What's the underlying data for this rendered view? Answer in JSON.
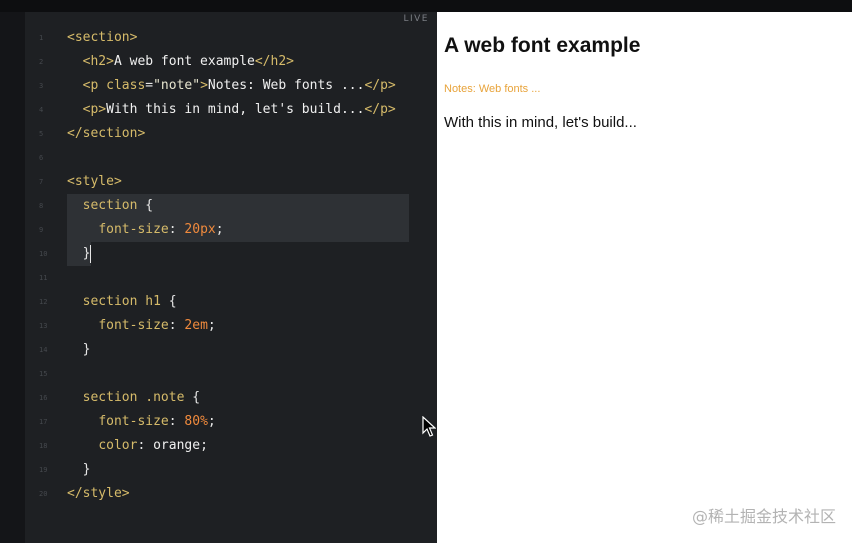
{
  "editor": {
    "live_label": "LIVE",
    "lines": [
      {
        "n": "1",
        "tokens": [
          {
            "t": "tag",
            "v": "<section>"
          }
        ]
      },
      {
        "n": "2",
        "tokens": [
          {
            "t": "punc",
            "v": "  "
          },
          {
            "t": "tag",
            "v": "<h2>"
          },
          {
            "t": "text",
            "v": "A web font example"
          },
          {
            "t": "tag",
            "v": "</h2>"
          }
        ]
      },
      {
        "n": "3",
        "tokens": [
          {
            "t": "punc",
            "v": "  "
          },
          {
            "t": "tag",
            "v": "<p "
          },
          {
            "t": "attr",
            "v": "class"
          },
          {
            "t": "punc",
            "v": "="
          },
          {
            "t": "str",
            "v": "\"note\""
          },
          {
            "t": "tag",
            "v": ">"
          },
          {
            "t": "text",
            "v": "Notes: Web fonts ..."
          },
          {
            "t": "tag",
            "v": "</p>"
          }
        ]
      },
      {
        "n": "4",
        "tokens": [
          {
            "t": "punc",
            "v": "  "
          },
          {
            "t": "tag",
            "v": "<p>"
          },
          {
            "t": "text",
            "v": "With this in mind, let's build..."
          },
          {
            "t": "tag",
            "v": "</p>"
          }
        ]
      },
      {
        "n": "5",
        "tokens": [
          {
            "t": "tag",
            "v": "</section>"
          }
        ]
      },
      {
        "n": "6",
        "tokens": []
      },
      {
        "n": "7",
        "tokens": [
          {
            "t": "tag",
            "v": "<style>"
          }
        ]
      },
      {
        "n": "8",
        "tokens": [
          {
            "t": "punc",
            "v": "  "
          },
          {
            "t": "prop",
            "v": "section"
          },
          {
            "t": "punc",
            "v": " {"
          }
        ]
      },
      {
        "n": "9",
        "tokens": [
          {
            "t": "punc",
            "v": "    "
          },
          {
            "t": "prop",
            "v": "font-size"
          },
          {
            "t": "punc",
            "v": ": "
          },
          {
            "t": "num",
            "v": "20px"
          },
          {
            "t": "punc",
            "v": ";"
          }
        ]
      },
      {
        "n": "10",
        "tokens": [
          {
            "t": "punc",
            "v": "  }"
          }
        ],
        "caret": true
      },
      {
        "n": "11",
        "tokens": []
      },
      {
        "n": "12",
        "tokens": [
          {
            "t": "punc",
            "v": "  "
          },
          {
            "t": "prop",
            "v": "section h1"
          },
          {
            "t": "punc",
            "v": " {"
          }
        ]
      },
      {
        "n": "13",
        "tokens": [
          {
            "t": "punc",
            "v": "    "
          },
          {
            "t": "prop",
            "v": "font-size"
          },
          {
            "t": "punc",
            "v": ": "
          },
          {
            "t": "num",
            "v": "2em"
          },
          {
            "t": "punc",
            "v": ";"
          }
        ]
      },
      {
        "n": "14",
        "tokens": [
          {
            "t": "punc",
            "v": "  }"
          }
        ]
      },
      {
        "n": "15",
        "tokens": []
      },
      {
        "n": "16",
        "tokens": [
          {
            "t": "punc",
            "v": "  "
          },
          {
            "t": "prop",
            "v": "section .note"
          },
          {
            "t": "punc",
            "v": " {"
          }
        ]
      },
      {
        "n": "17",
        "tokens": [
          {
            "t": "punc",
            "v": "    "
          },
          {
            "t": "prop",
            "v": "font-size"
          },
          {
            "t": "punc",
            "v": ": "
          },
          {
            "t": "num",
            "v": "80%"
          },
          {
            "t": "punc",
            "v": ";"
          }
        ]
      },
      {
        "n": "18",
        "tokens": [
          {
            "t": "punc",
            "v": "    "
          },
          {
            "t": "prop",
            "v": "color"
          },
          {
            "t": "punc",
            "v": ": "
          },
          {
            "t": "text",
            "v": "orange"
          },
          {
            "t": "punc",
            "v": ";"
          }
        ]
      },
      {
        "n": "19",
        "tokens": [
          {
            "t": "punc",
            "v": "  }"
          }
        ]
      },
      {
        "n": "20",
        "tokens": [
          {
            "t": "tag",
            "v": "</style>"
          }
        ]
      }
    ]
  },
  "preview": {
    "heading": "A web font example",
    "note": "Notes: Web fonts ...",
    "paragraph": "With this in mind, let's build..."
  },
  "watermark": "@稀土掘金技术社区",
  "colors": {
    "editor_bg": "#1e2023",
    "tag": "#d6bb6a",
    "number": "#f08a3d",
    "note_orange": "#e8a33a"
  }
}
